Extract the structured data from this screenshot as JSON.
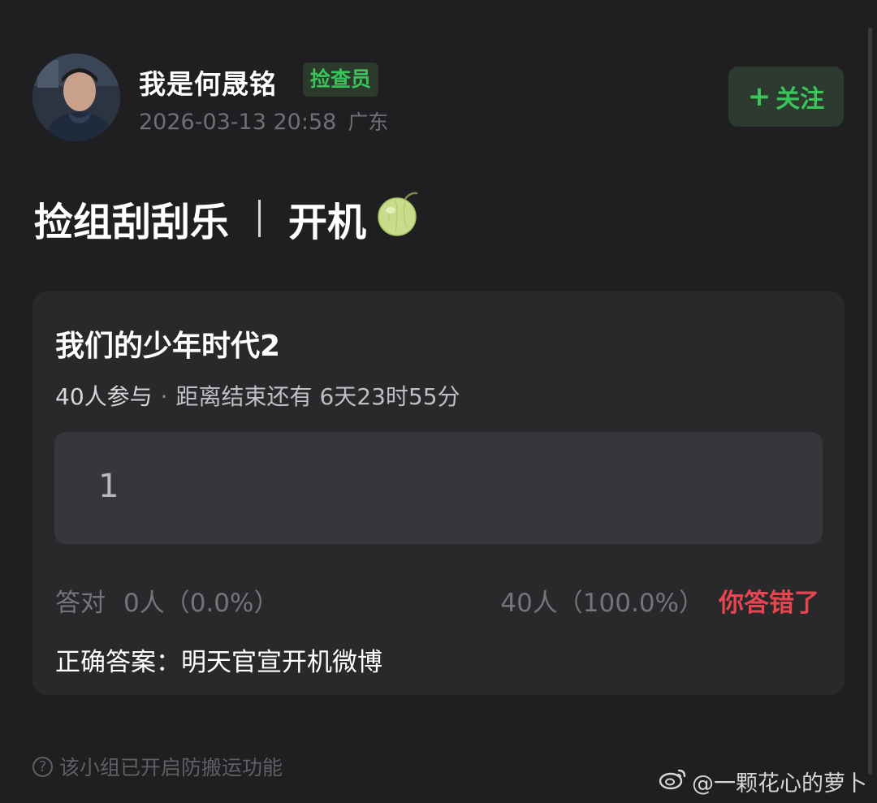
{
  "post": {
    "author_name": "我是何晟铭",
    "role_badge": "捡查员",
    "timestamp": "2026-03-13 20:58",
    "location": "广东",
    "follow_button": "+ 关注",
    "follow_plus": "+",
    "follow_label": "关注",
    "title_left": "捡组刮刮乐",
    "title_right": "开机"
  },
  "quiz": {
    "title": "我们的少年时代2",
    "participants": "40人参与",
    "time_remaining": "距离结束还有 6天23时55分",
    "answer_value": "1",
    "correct_label": "答对",
    "correct_stats": "0人（0.0%）",
    "wrong_stats": "40人（100.0%）",
    "result_text": "你答错了",
    "correct_answer": "正确答案：明天官宣开机微博"
  },
  "footer": {
    "note": "该小组已开启防搬运功能"
  },
  "watermark": {
    "text": "@一颗花心的萝卜"
  },
  "colors": {
    "background": "#1f1f22",
    "card": "#29292c",
    "accent_green": "#39c55a",
    "error_red": "#e8454f"
  },
  "icons": [
    "help-circle-icon",
    "melon-emoji-icon",
    "weibo-logo-icon"
  ]
}
